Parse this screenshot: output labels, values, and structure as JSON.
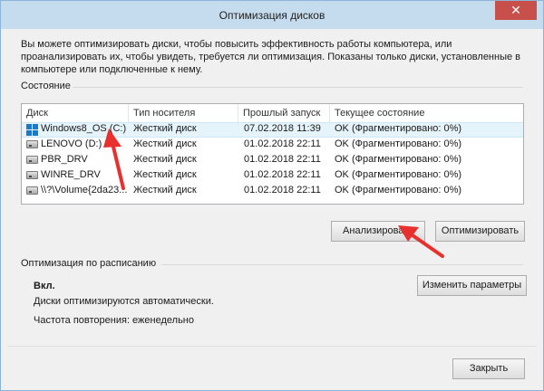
{
  "window": {
    "title": "Оптимизация дисков",
    "close_glyph": "✕"
  },
  "description": "Вы можете оптимизировать диски, чтобы повысить эффективность работы  компьютера, или проанализировать их, чтобы увидеть, требуется ли оптимизация. Показаны только диски, установленные в компьютере или подключенные к нему.",
  "status": {
    "label": "Состояние",
    "columns": [
      "Диск",
      "Тип носителя",
      "Прошлый запуск",
      "Текущее состояние"
    ],
    "rows": [
      {
        "disk": "Windows8_OS (C:)",
        "icon": "windows-drive-icon",
        "media": "Жесткий диск",
        "last_run": "07.02.2018 11:39",
        "state": "OK (Фрагментировано: 0%)",
        "selected": true
      },
      {
        "disk": "LENOVO (D:)",
        "icon": "hard-drive-icon",
        "media": "Жесткий диск",
        "last_run": "01.02.2018 22:11",
        "state": "OK (Фрагментировано: 0%)"
      },
      {
        "disk": "PBR_DRV",
        "icon": "hard-drive-icon",
        "media": "Жесткий диск",
        "last_run": "01.02.2018 22:11",
        "state": "OK (Фрагментировано: 0%)"
      },
      {
        "disk": "WINRE_DRV",
        "icon": "hard-drive-icon",
        "media": "Жесткий диск",
        "last_run": "01.02.2018 22:11",
        "state": "OK (Фрагментировано: 0%)"
      },
      {
        "disk": "\\\\?\\Volume{2da23...",
        "icon": "hard-drive-icon",
        "media": "Жесткий диск",
        "last_run": "01.02.2018 22:11",
        "state": "OK (Фрагментировано: 0%)"
      }
    ],
    "analyze_label": "Анализировать",
    "optimize_label": "Оптимизировать"
  },
  "schedule": {
    "label": "Оптимизация по расписанию",
    "state": "Вкл.",
    "auto_text": "Диски оптимизируются автоматически.",
    "frequency_text": "Частота повторения: еженедельно",
    "change_label": "Изменить параметры"
  },
  "footer": {
    "close_label": "Закрыть"
  },
  "colors": {
    "annotation_arrow": "#e8312f",
    "title_bar": "#c5dbee",
    "close_button": "#c7504a"
  }
}
